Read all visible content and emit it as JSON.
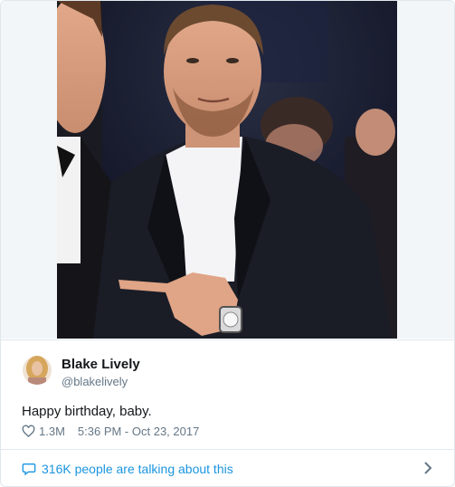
{
  "tweet": {
    "display_name": "Blake Lively",
    "handle": "@blakelively",
    "text": "Happy birthday, baby.",
    "likes": "1.3M",
    "timestamp": "5:36 PM - Oct 23, 2017"
  },
  "footer": {
    "talking_label": "316K people are talking about this"
  },
  "icons": {
    "like": "heart-icon",
    "conversation": "speech-bubble-icon",
    "more": "chevron-right-icon"
  },
  "colors": {
    "link_blue": "#1b95e0",
    "secondary_text": "#657786",
    "border": "#e1e8ed"
  }
}
